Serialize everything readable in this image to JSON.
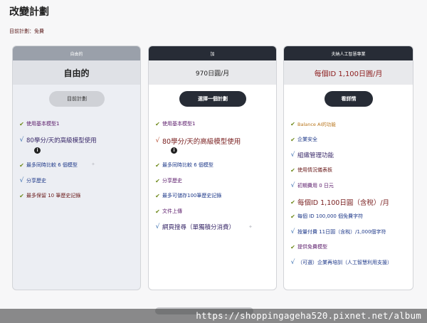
{
  "page": {
    "title": "改變計劃",
    "current_plan": "目前計劃：免費"
  },
  "plans": {
    "free": {
      "header": "自由的",
      "price": "自由的",
      "button": "目前計劃",
      "features": [
        "使用基本模型1",
        "80學分/天的高級模型使用",
        "最多同時比較 6 個模型",
        "分享歷史",
        "最多保留 10 筆歷史記錄"
      ]
    },
    "plus": {
      "header": "加",
      "price": "970日圓/月",
      "button": "選擇一個計劃",
      "features": [
        "使用基本模型1",
        "80學分/天的高級模型使用",
        "最多同時比較 6 個模型",
        "分享歷史",
        "最多可儲存100筆歷史記錄",
        "文件上傳",
        "網頁搜尋（單獨積分消費）"
      ]
    },
    "business": {
      "header": "夫納人工智慧專業",
      "price": "每個ID 1,100日圓/月",
      "button": "看詳情",
      "features": [
        "Balance AI的功能",
        "企業安全",
        "組織管理功能",
        "使用情況儀表板",
        "初期費用 0 日元",
        "每個ID 1,100日圓（含稅）/月",
        "每個 ID 100,000 個免費字符",
        "按量付費 11日圓（含稅）/1,000個字符",
        "提供免費模型",
        "（可選）企業再培訓（人工智慧利用支援）"
      ]
    }
  },
  "icons": {
    "check": "checkmark-icon",
    "info": "info-icon",
    "sparkle": "sparkle-icon"
  },
  "info_glyph": "i",
  "watermark": "https://shoppingageha520.pixnet.net/album",
  "colors": {
    "dark_header": "#272c36",
    "free_header": "#9aa0aa",
    "check_green": "#6f8a1c"
  }
}
